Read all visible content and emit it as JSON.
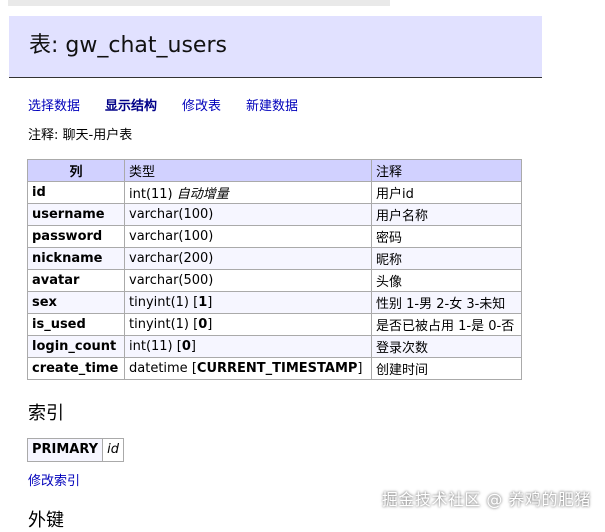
{
  "page": {
    "title": "表: gw_chat_users"
  },
  "nav": {
    "items": [
      {
        "label": "选择数据"
      },
      {
        "label": "显示结构"
      },
      {
        "label": "修改表"
      },
      {
        "label": "新建数据"
      }
    ],
    "active": "显示结构"
  },
  "comment": "注释: 聊天-用户表",
  "table": {
    "headers": [
      "列",
      "类型",
      "注释"
    ],
    "rows": [
      {
        "name": "id",
        "type": "int(11)",
        "extra": "自动增量",
        "default": "",
        "comment": "用户id"
      },
      {
        "name": "username",
        "type": "varchar(100)",
        "extra": "",
        "default": "",
        "comment": "用户名称"
      },
      {
        "name": "password",
        "type": "varchar(100)",
        "extra": "",
        "default": "",
        "comment": "密码"
      },
      {
        "name": "nickname",
        "type": "varchar(200)",
        "extra": "",
        "default": "",
        "comment": "昵称"
      },
      {
        "name": "avatar",
        "type": "varchar(500)",
        "extra": "",
        "default": "",
        "comment": "头像"
      },
      {
        "name": "sex",
        "type": "tinyint(1)",
        "extra": "",
        "default": "1",
        "comment": "性别 1-男 2-女 3-未知"
      },
      {
        "name": "is_used",
        "type": "tinyint(1)",
        "extra": "",
        "default": "0",
        "comment": "是否已被占用 1-是 0-否"
      },
      {
        "name": "login_count",
        "type": "int(11)",
        "extra": "",
        "default": "0",
        "comment": "登录次数"
      },
      {
        "name": "create_time",
        "type": "datetime",
        "extra": "",
        "default": "CURRENT_TIMESTAMP",
        "comment": "创建时间"
      }
    ]
  },
  "indexes": {
    "title": "索引",
    "items": [
      {
        "type": "PRIMARY",
        "columns": "id"
      }
    ],
    "edit_link": "修改索引"
  },
  "foreign_keys": {
    "title": "外键"
  },
  "watermark": "掘金技术社区 @ 养鸡的肥猪"
}
